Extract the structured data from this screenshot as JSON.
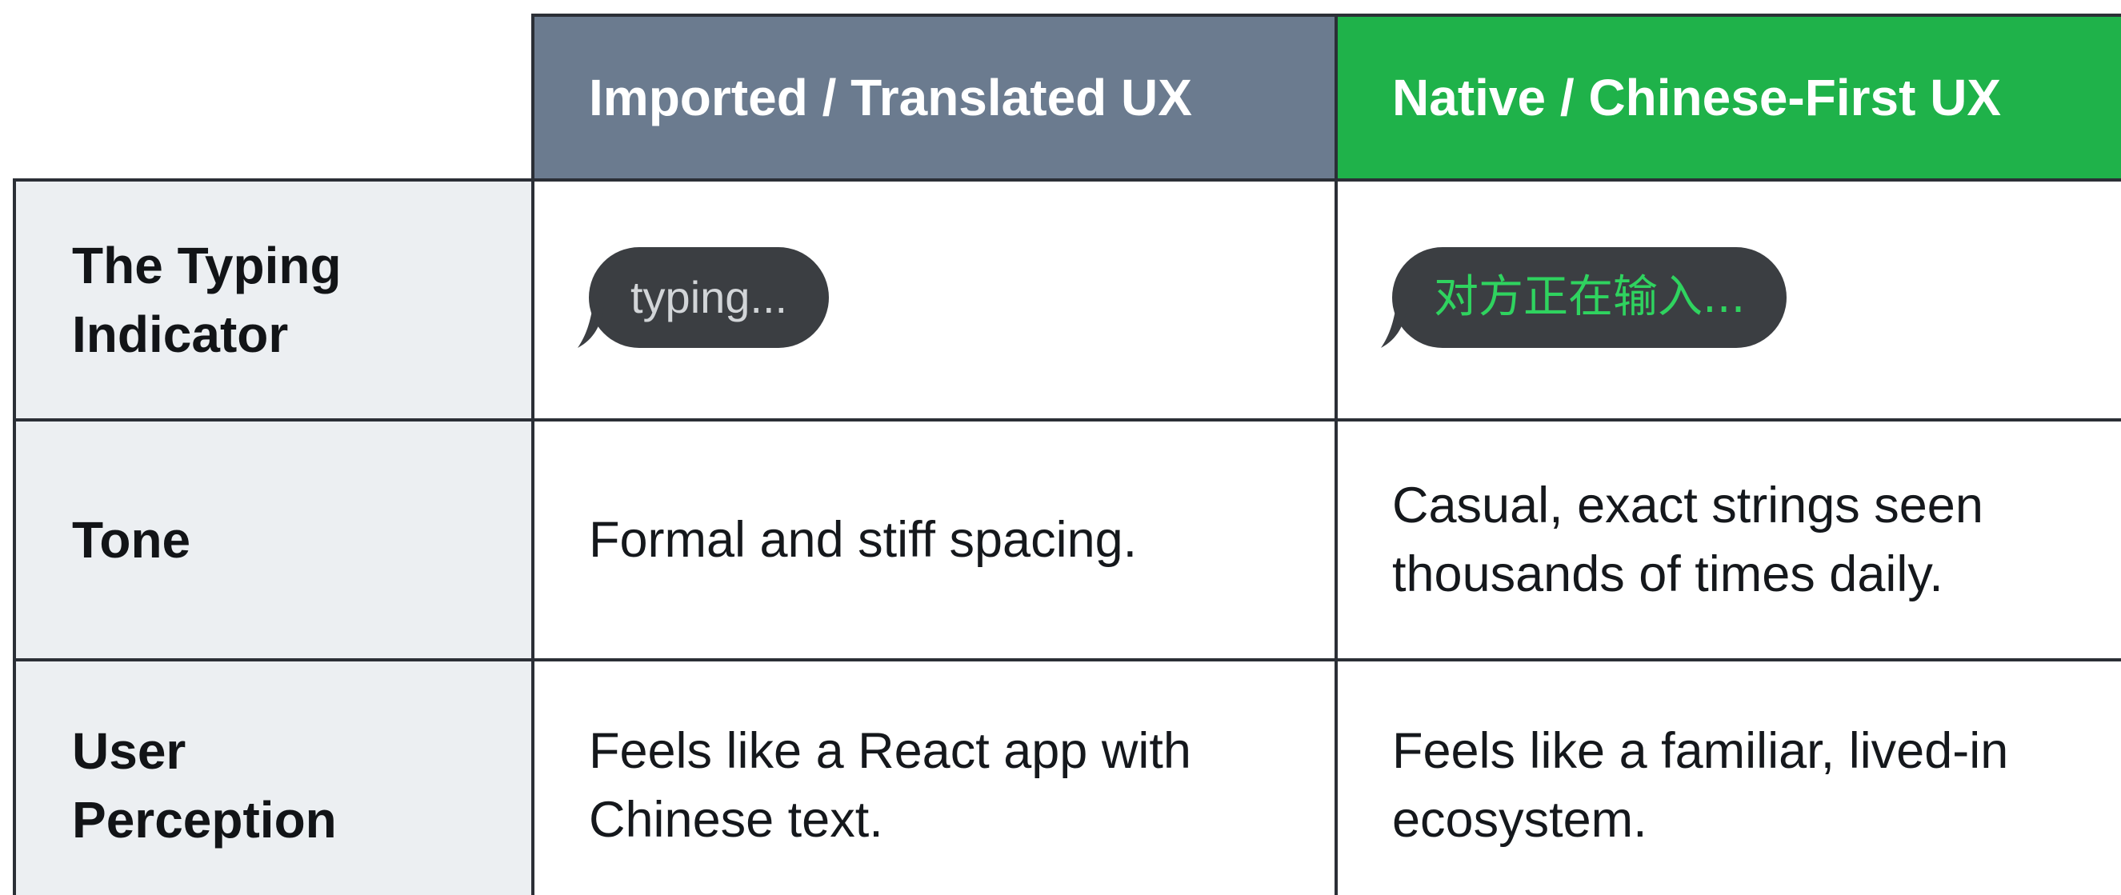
{
  "columns": {
    "imported": "Imported / Translated UX",
    "native": "Native / Chinese-First UX"
  },
  "rows": [
    {
      "label": "The Typing Indicator",
      "imported": "typing...",
      "native": "对方正在输入..."
    },
    {
      "label": "Tone",
      "imported": "Formal and stiff spacing.",
      "native": "Casual, exact strings seen thousands of times daily."
    },
    {
      "label": "User Perception",
      "imported": "Feels like a React app with Chinese text.",
      "native": "Feels like a familiar, lived-in ecosystem."
    }
  ],
  "colors": {
    "imported_header": "#6b7b8f",
    "native_header": "#1fb24a",
    "label_column": "#eceff2",
    "bubble": "#3b3e42",
    "native_bubble_text": "#2fd35f"
  },
  "icons": [
    "chat-bubble-icon"
  ]
}
